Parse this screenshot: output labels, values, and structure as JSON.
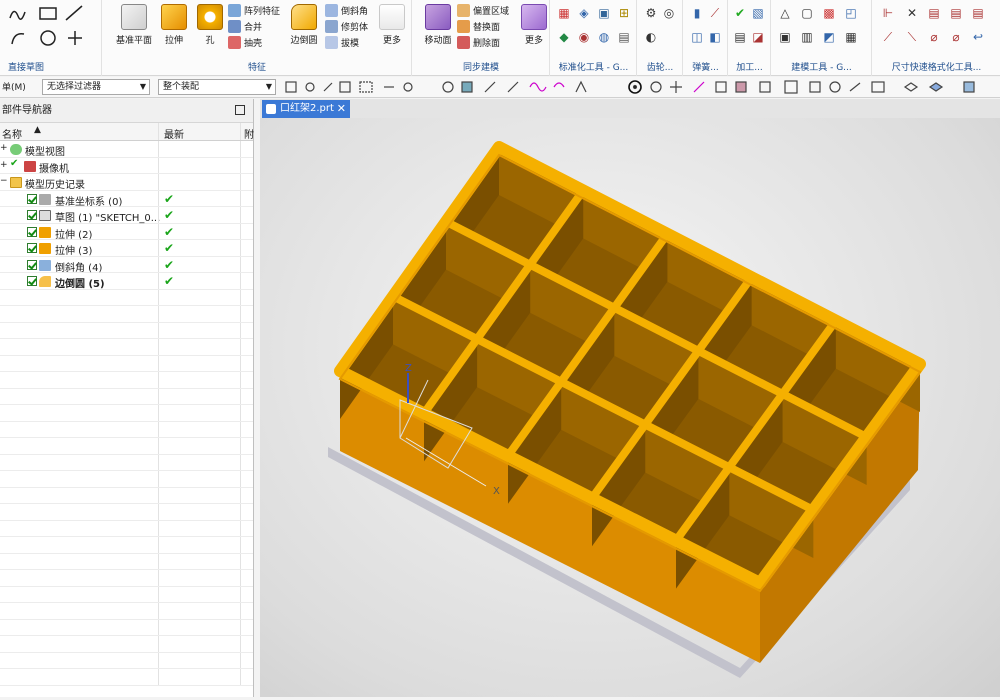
{
  "ribbon": {
    "sketch": {
      "label": "直接草图"
    },
    "feature": {
      "label": "特征",
      "datum_plane": "基准平面",
      "extrude": "拉伸",
      "hole": "孔",
      "pattern": "阵列特征",
      "unite": "合并",
      "shell": "抽壳",
      "edge_blend": "边倒圆",
      "chamfer": "倒斜角",
      "trim_body": "修剪体",
      "draft": "拔模",
      "more": "更多"
    },
    "sync": {
      "label": "同步建模",
      "move_face": "移动面",
      "offset_region": "偏置区域",
      "replace_face": "替换面",
      "delete_face": "删除面",
      "more": "更多"
    },
    "groups": [
      "标准化工具 - G...",
      "齿轮...",
      "弹簧...",
      "加工...",
      "建模工具 - G...",
      "尺寸快速格式化工具..."
    ]
  },
  "selbar": {
    "menu": "单(M)",
    "filter": "无选择过滤器",
    "scope": "整个装配"
  },
  "navigator": {
    "title": "部件导航器",
    "col_name": "名称",
    "col_latest": "最新",
    "col_extra": "附",
    "items": [
      {
        "label": "模型视图",
        "check": false
      },
      {
        "label": "摄像机",
        "check": false
      },
      {
        "label": "模型历史记录",
        "check": false
      },
      {
        "label": "基准坐标系 (0)",
        "check": true
      },
      {
        "label": "草图 (1) \"SKETCH_0...",
        "check": true
      },
      {
        "label": "拉伸 (2)",
        "check": true
      },
      {
        "label": "拉伸 (3)",
        "check": true
      },
      {
        "label": "倒斜角 (4)",
        "check": true
      },
      {
        "label": "边倒圆 (5)",
        "check": true
      }
    ]
  },
  "tab": {
    "title": "口红架2.prt"
  },
  "axis": {
    "z": "Z",
    "x": "X"
  },
  "colors": {
    "model": "#f5a800",
    "inner": "#8a5a00",
    "accent": "#3b79d6"
  }
}
